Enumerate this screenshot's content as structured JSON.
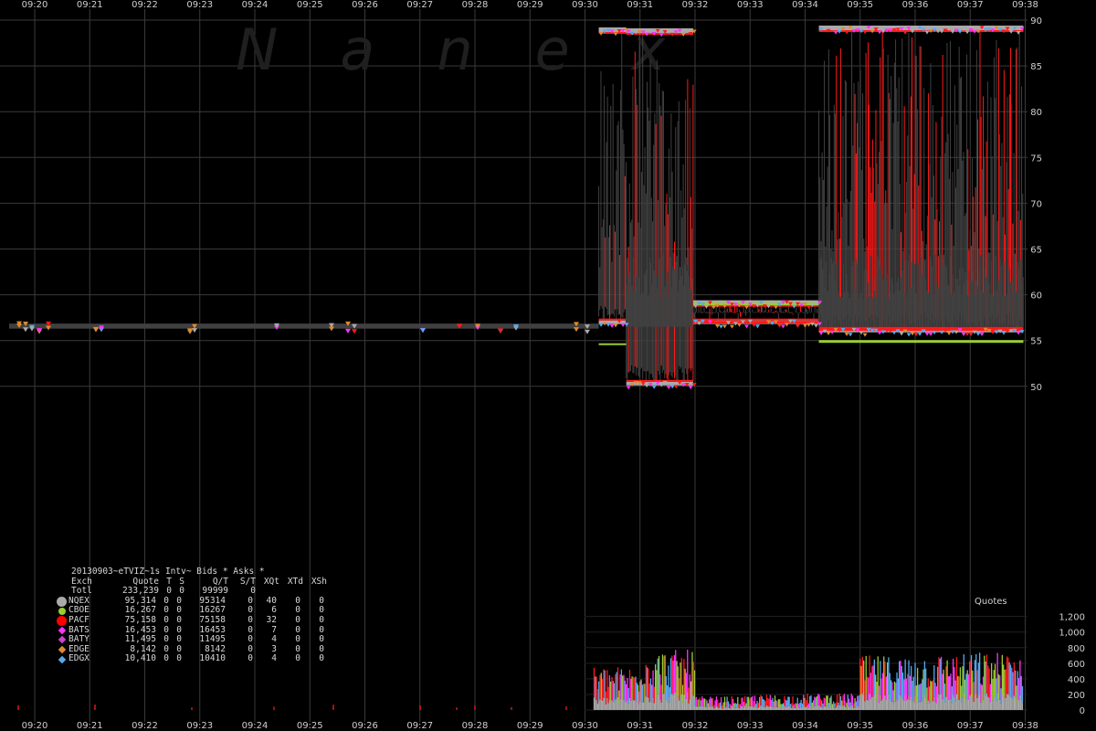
{
  "watermark": "Nanex",
  "chart_data": [
    {
      "type": "scatter",
      "title": "",
      "xlabel": "",
      "ylabel": "",
      "x_ticks": [
        "09:20",
        "09:21",
        "09:22",
        "09:23",
        "09:24",
        "09:25",
        "09:26",
        "09:27",
        "09:28",
        "09:29",
        "09:30",
        "09:31",
        "09:32",
        "09:33",
        "09:34",
        "09:35",
        "09:36",
        "09:37",
        "09:38"
      ],
      "ylim": [
        48,
        90.5
      ],
      "y_ticks": [
        50,
        55,
        60,
        65,
        70,
        75,
        80,
        85,
        90
      ],
      "grid": true,
      "series": [
        {
          "name": "Bids",
          "x": [
            "09:20",
            "09:21",
            "09:22",
            "09:23",
            "09:24",
            "09:25",
            "09:26",
            "09:27",
            "09:28",
            "09:29",
            "09:30:15",
            "09:30:45",
            "09:31:30",
            "09:32:30",
            "09:33:30",
            "09:34:15",
            "09:35",
            "09:36",
            "09:37",
            "09:37:50"
          ],
          "y": [
            56.3,
            56.3,
            56.4,
            56.4,
            56.5,
            56.5,
            56.5,
            56.5,
            56.6,
            56.6,
            54.5,
            50.3,
            50.3,
            57.0,
            56.9,
            56.1,
            56.2,
            56.3,
            56.4,
            56.1
          ]
        },
        {
          "name": "Asks",
          "x": [
            "09:20",
            "09:21",
            "09:22",
            "09:23",
            "09:24",
            "09:25",
            "09:26",
            "09:27",
            "09:28",
            "09:29",
            "09:30:15",
            "09:30:45",
            "09:31:30",
            "09:32:30",
            "09:33:30",
            "09:34:15",
            "09:35",
            "09:36",
            "09:37",
            "09:37:50"
          ],
          "y": [
            56.8,
            56.8,
            56.9,
            56.9,
            57.0,
            57.0,
            57.0,
            57.0,
            57.1,
            57.1,
            88.9,
            88.8,
            88.8,
            59.1,
            59.2,
            89.1,
            89.0,
            89.0,
            89.0,
            89.0
          ]
        }
      ],
      "legend_position": "bottom-left"
    },
    {
      "type": "bar",
      "title": "Quotes",
      "x_ticks": [
        "09:20",
        "09:21",
        "09:22",
        "09:23",
        "09:24",
        "09:25",
        "09:26",
        "09:27",
        "09:28",
        "09:29",
        "09:30",
        "09:31",
        "09:32",
        "09:33",
        "09:34",
        "09:35",
        "09:36",
        "09:37",
        "09:38"
      ],
      "ylim": [
        0,
        1200
      ],
      "y_ticks": [
        0,
        200,
        400,
        600,
        800,
        "1,000",
        "1,200"
      ],
      "categories": [
        "09:30",
        "09:31",
        "09:32",
        "09:33",
        "09:34",
        "09:35",
        "09:36",
        "09:37"
      ],
      "values": [
        450,
        620,
        140,
        160,
        170,
        560,
        580,
        600
      ]
    }
  ],
  "stats_panel": {
    "title": "20130903~eTVIZ~1s Intv~ Bids * Asks *",
    "header": [
      "Exch",
      "Quote",
      "T",
      "S",
      "Q/T",
      "S/T",
      "XQt",
      "XTd",
      "XSh"
    ],
    "total": [
      "Totl",
      "233,239",
      "0",
      "0",
      "99999",
      "0",
      "",
      "",
      ""
    ],
    "rows": [
      {
        "marker": "circle-big",
        "color": "#aaaaaa",
        "cells": [
          "NQEX",
          "95,314",
          "0",
          "0",
          "95314",
          "0",
          "40",
          "0",
          "0"
        ]
      },
      {
        "marker": "circle",
        "color": "#9acd32",
        "cells": [
          "CBOE",
          "16,267",
          "0",
          "0",
          "16267",
          "0",
          "6",
          "0",
          "0"
        ]
      },
      {
        "marker": "circle-big",
        "color": "#ff0000",
        "cells": [
          "PACF",
          "75,158",
          "0",
          "0",
          "75158",
          "0",
          "32",
          "0",
          "0"
        ]
      },
      {
        "marker": "diamond",
        "color": "#ff33ff",
        "cells": [
          "BATS",
          "16,453",
          "0",
          "0",
          "16453",
          "0",
          "7",
          "0",
          "0"
        ]
      },
      {
        "marker": "diamond",
        "color": "#cc44cc",
        "cells": [
          "BATY",
          "11,495",
          "0",
          "0",
          "11495",
          "0",
          "4",
          "0",
          "0"
        ]
      },
      {
        "marker": "diamond",
        "color": "#e08a2c",
        "cells": [
          "EDGE",
          "8,142",
          "0",
          "0",
          "8142",
          "0",
          "3",
          "0",
          "0"
        ]
      },
      {
        "marker": "diamond",
        "color": "#55aaee",
        "cells": [
          "EDGX",
          "10,410",
          "0",
          "0",
          "10410",
          "0",
          "4",
          "0",
          "0"
        ]
      }
    ]
  },
  "colors": {
    "background": "#000000",
    "grid": "#3a3a3a",
    "spread": "#404040",
    "pacf": "#ff1a1a",
    "cboe": "#9acd32",
    "nqex": "#aaaaaa",
    "bats": "#ff33ff",
    "edgx": "#55aaee",
    "edge": "#e08a2c"
  }
}
